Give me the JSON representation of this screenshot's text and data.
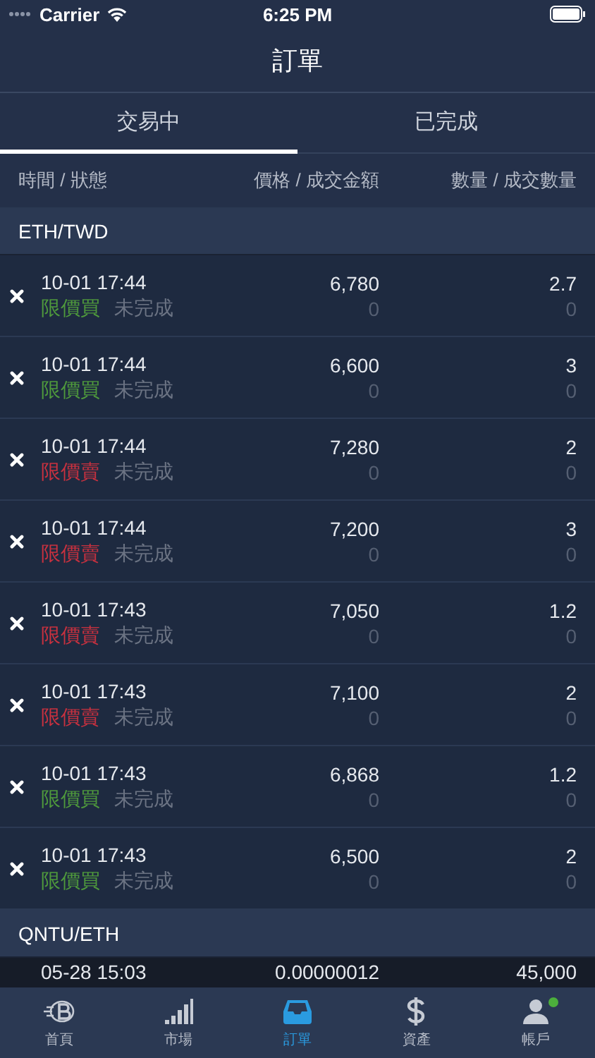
{
  "status_bar": {
    "carrier": "Carrier",
    "time": "6:25 PM"
  },
  "nav": {
    "title": "訂單"
  },
  "tabs": [
    {
      "label": "交易中",
      "selected": true
    },
    {
      "label": "已完成",
      "selected": false
    }
  ],
  "columns": [
    "時間 / 狀態",
    "價格 / 成交金額",
    "數量 / 成交數量"
  ],
  "groups": [
    {
      "pair": "ETH/TWD",
      "orders": [
        {
          "time": "10-01 17:44",
          "type": "限價買",
          "color": "#4f9a3c",
          "status": "未完成",
          "price": "6,780",
          "filled_amount": "0",
          "quantity": "2.7",
          "filled_quantity": "0"
        },
        {
          "time": "10-01 17:44",
          "type": "限價買",
          "color": "#4f9a3c",
          "status": "未完成",
          "price": "6,600",
          "filled_amount": "0",
          "quantity": "3",
          "filled_quantity": "0"
        },
        {
          "time": "10-01 17:44",
          "type": "限價賣",
          "color": "#c9313f",
          "status": "未完成",
          "price": "7,280",
          "filled_amount": "0",
          "quantity": "2",
          "filled_quantity": "0"
        },
        {
          "time": "10-01 17:44",
          "type": "限價賣",
          "color": "#c9313f",
          "status": "未完成",
          "price": "7,200",
          "filled_amount": "0",
          "quantity": "3",
          "filled_quantity": "0"
        },
        {
          "time": "10-01 17:43",
          "type": "限價賣",
          "color": "#c9313f",
          "status": "未完成",
          "price": "7,050",
          "filled_amount": "0",
          "quantity": "1.2",
          "filled_quantity": "0"
        },
        {
          "time": "10-01 17:43",
          "type": "限價賣",
          "color": "#c9313f",
          "status": "未完成",
          "price": "7,100",
          "filled_amount": "0",
          "quantity": "2",
          "filled_quantity": "0"
        },
        {
          "time": "10-01 17:43",
          "type": "限價買",
          "color": "#4f9a3c",
          "status": "未完成",
          "price": "6,868",
          "filled_amount": "0",
          "quantity": "1.2",
          "filled_quantity": "0"
        },
        {
          "time": "10-01 17:43",
          "type": "限價買",
          "color": "#4f9a3c",
          "status": "未完成",
          "price": "6,500",
          "filled_amount": "0",
          "quantity": "2",
          "filled_quantity": "0"
        }
      ]
    },
    {
      "pair": "QNTU/ETH",
      "orders": [
        {
          "time": "05-28 15:03",
          "price": "0.00000012",
          "quantity": "45,000"
        }
      ]
    }
  ],
  "tab_bar": [
    {
      "label": "首頁",
      "kind": "logo",
      "selected": false,
      "badge": false
    },
    {
      "label": "市場",
      "kind": "bars",
      "selected": false,
      "badge": false
    },
    {
      "label": "訂單",
      "kind": "tray",
      "selected": true,
      "badge": false
    },
    {
      "label": "資產",
      "kind": "dollar",
      "selected": false,
      "badge": false
    },
    {
      "label": "帳戶",
      "kind": "person",
      "selected": false,
      "badge": true
    }
  ]
}
